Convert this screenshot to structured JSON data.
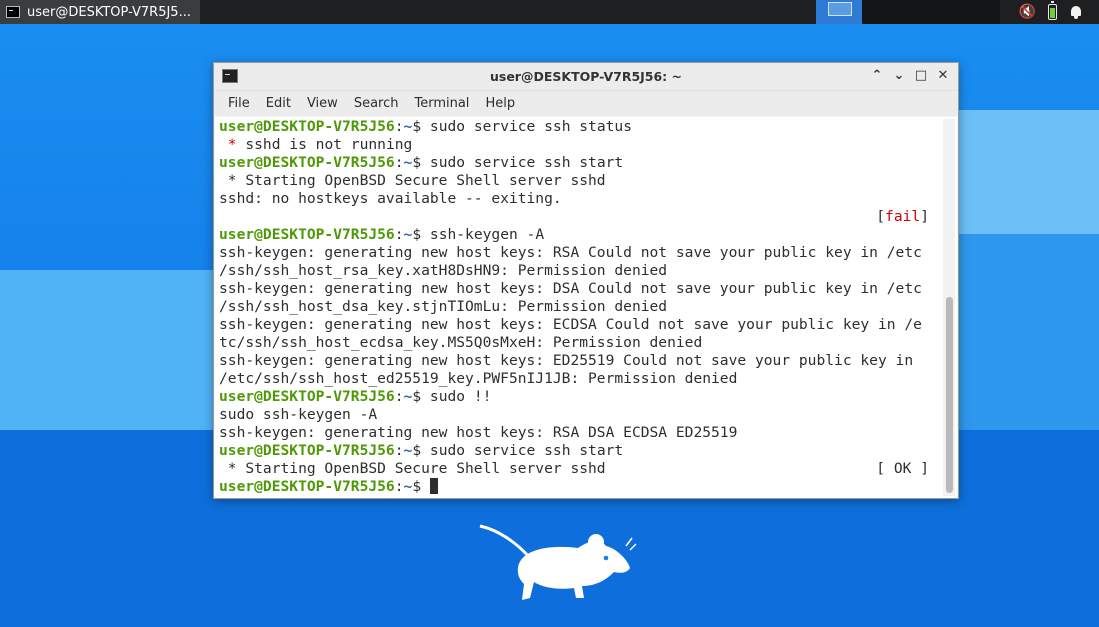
{
  "panel": {
    "task_title": "user@DESKTOP-V7R5J5...",
    "icons": [
      "terminal-icon",
      "mute-speaker-icon",
      "battery-icon",
      "notification-bell-icon"
    ]
  },
  "window": {
    "title": "user@DESKTOP-V7R5J56: ~",
    "controls": [
      "^",
      "v",
      "□",
      "✕"
    ],
    "menu": [
      "File",
      "Edit",
      "View",
      "Search",
      "Terminal",
      "Help"
    ]
  },
  "terminal": {
    "prompt_user": "user@DESKTOP-V7R5J56",
    "prompt_sep": ":",
    "prompt_path": "~",
    "prompt_end": "$ ",
    "lines": [
      {
        "type": "cmd",
        "text": "sudo service ssh status"
      },
      {
        "type": "star",
        "star": " *",
        "text": " sshd is not running"
      },
      {
        "type": "cmd",
        "text": "sudo service ssh start"
      },
      {
        "type": "out",
        "text": " * Starting OpenBSD Secure Shell server sshd"
      },
      {
        "type": "out",
        "text": "sshd: no hostkeys available -- exiting."
      },
      {
        "type": "fail",
        "text": "[fail]"
      },
      {
        "type": "cmd",
        "text": "ssh-keygen -A"
      },
      {
        "type": "out",
        "text": "ssh-keygen: generating new host keys: RSA Could not save your public key in /etc"
      },
      {
        "type": "out",
        "text": "/ssh/ssh_host_rsa_key.xatH8DsHN9: Permission denied"
      },
      {
        "type": "out",
        "text": "ssh-keygen: generating new host keys: DSA Could not save your public key in /etc"
      },
      {
        "type": "out",
        "text": "/ssh/ssh_host_dsa_key.stjnTIOmLu: Permission denied"
      },
      {
        "type": "out",
        "text": "ssh-keygen: generating new host keys: ECDSA Could not save your public key in /e"
      },
      {
        "type": "out",
        "text": "tc/ssh/ssh_host_ecdsa_key.MS5Q0sMxeH: Permission denied"
      },
      {
        "type": "out",
        "text": "ssh-keygen: generating new host keys: ED25519 Could not save your public key in"
      },
      {
        "type": "out",
        "text": "/etc/ssh/ssh_host_ed25519_key.PWF5nIJ1JB: Permission denied"
      },
      {
        "type": "cmd",
        "text": "sudo !!"
      },
      {
        "type": "out",
        "text": "sudo ssh-keygen -A"
      },
      {
        "type": "out",
        "text": "ssh-keygen: generating new host keys: RSA DSA ECDSA ED25519"
      },
      {
        "type": "cmd",
        "text": "sudo service ssh start"
      },
      {
        "type": "ok",
        "text": " * Starting OpenBSD Secure Shell server sshd",
        "tag": "[ OK ]"
      },
      {
        "type": "cursor",
        "text": ""
      }
    ]
  },
  "colors": {
    "prompt_green": "#4e9a06",
    "path_blue": "#3465a4",
    "fail_red": "#cc0000",
    "desktop_blue": "#1580ea"
  }
}
